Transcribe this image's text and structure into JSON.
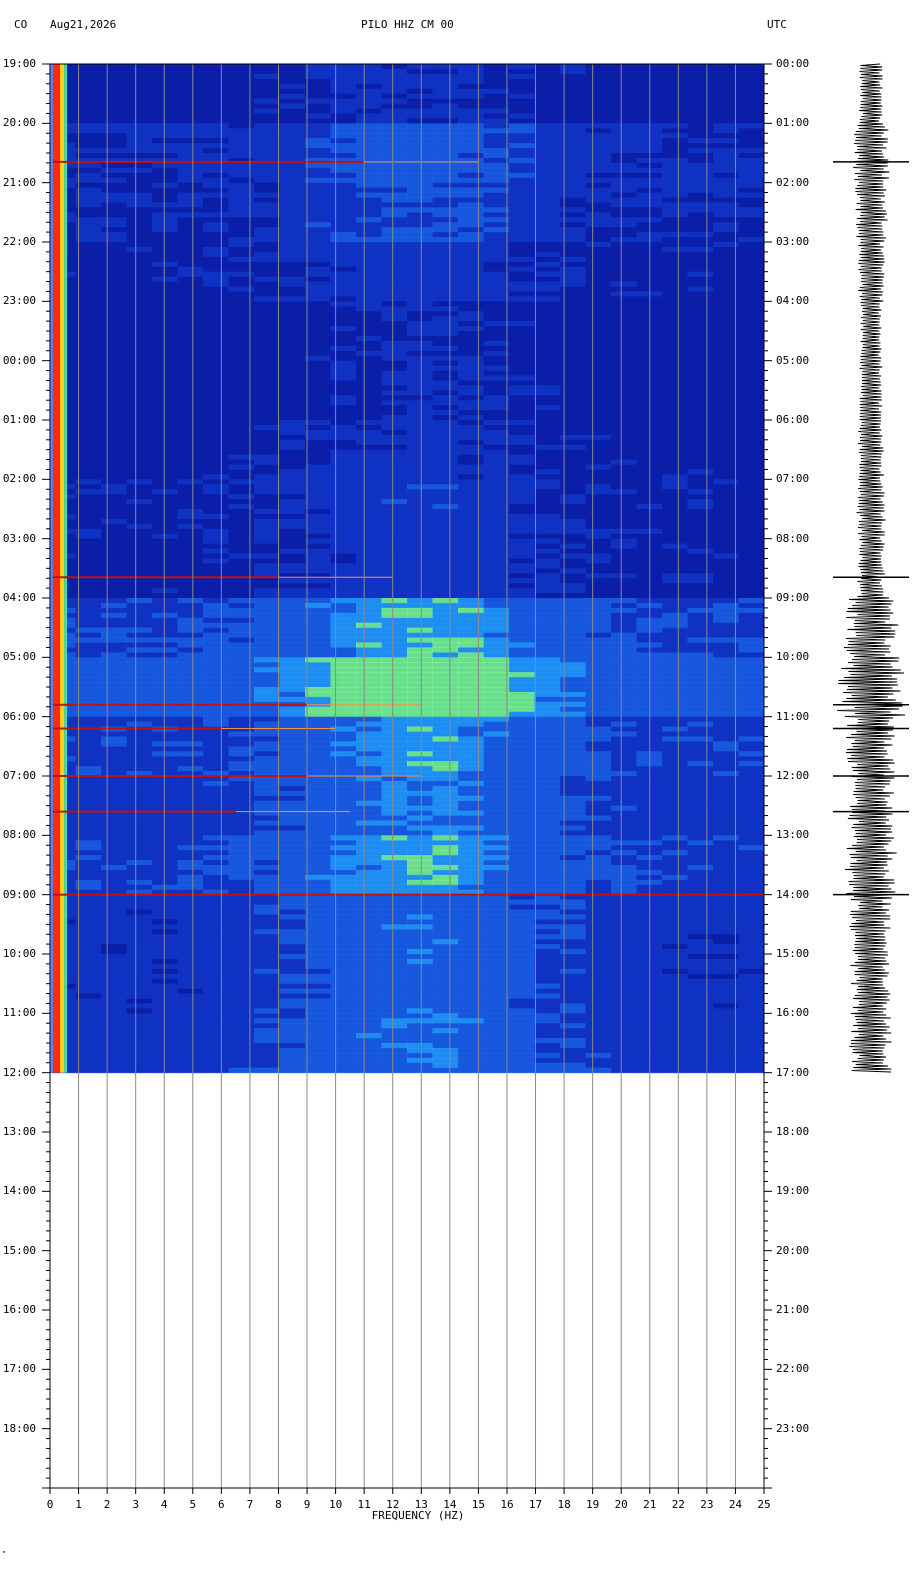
{
  "header": {
    "network": "CO",
    "date": "Aug21,2026",
    "station": "PILO HHZ CM 00",
    "timezone": "UTC"
  },
  "chart_data": {
    "type": "heatmap",
    "xlabel": "FREQUENCY (HZ)",
    "xlim": [
      0,
      25
    ],
    "x_ticks": [
      "0",
      "1",
      "2",
      "3",
      "4",
      "5",
      "6",
      "7",
      "8",
      "9",
      "10",
      "11",
      "12",
      "13",
      "14",
      "15",
      "16",
      "17",
      "18",
      "19",
      "20",
      "21",
      "22",
      "23",
      "24",
      "25"
    ],
    "left_time_labels": [
      "19:00",
      "20:00",
      "21:00",
      "22:00",
      "23:00",
      "00:00",
      "01:00",
      "02:00",
      "03:00",
      "04:00",
      "05:00",
      "06:00",
      "07:00",
      "08:00",
      "09:00",
      "10:00",
      "11:00",
      "12:00",
      "13:00",
      "14:00",
      "15:00",
      "16:00",
      "17:00",
      "18:00"
    ],
    "right_time_labels": [
      "00:00",
      "01:00",
      "02:00",
      "03:00",
      "04:00",
      "05:00",
      "06:00",
      "07:00",
      "08:00",
      "09:00",
      "10:00",
      "11:00",
      "12:00",
      "13:00",
      "14:00",
      "15:00",
      "16:00",
      "17:00",
      "18:00",
      "19:00",
      "20:00",
      "21:00",
      "22:00",
      "23:00"
    ],
    "data_end_hours": 17,
    "total_hours": 24,
    "spectrogram_hour_levels": [
      0.15,
      0.32,
      0.28,
      0.2,
      0.12,
      0.14,
      0.18,
      0.22,
      0.2,
      0.55,
      0.72,
      0.5,
      0.45,
      0.52,
      0.4,
      0.38,
      0.42
    ],
    "event_lines": [
      {
        "hour": 1.65,
        "fmax": 11
      },
      {
        "hour": 8.65,
        "fmax": 8
      },
      {
        "hour": 10.8,
        "fmax": 9
      },
      {
        "hour": 11.2,
        "fmax": 6
      },
      {
        "hour": 12.0,
        "fmax": 9
      },
      {
        "hour": 12.6,
        "fmax": 6.5
      },
      {
        "hour": 14.0,
        "fmax": 25
      }
    ],
    "grid": true,
    "colors": {
      "background": "#0a1fa8",
      "low": "#1036c8",
      "mid": "#23a0ff",
      "high": "#7dff8a",
      "event": "#c01010",
      "edge": "#ffd020"
    }
  },
  "marks": {
    "bottom_left": "\""
  }
}
